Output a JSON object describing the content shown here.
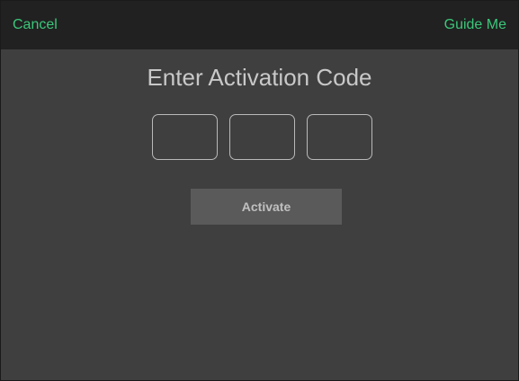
{
  "nav": {
    "cancel_label": "Cancel",
    "guide_label": "Guide Me"
  },
  "main": {
    "title": "Enter Activation Code",
    "code_fields": [
      {
        "value": ""
      },
      {
        "value": ""
      },
      {
        "value": ""
      }
    ],
    "activate_label": "Activate"
  },
  "colors": {
    "accent": "#3bc77a",
    "nav_background": "#212121",
    "background": "#3f3f3f",
    "button_background": "#5a5a5a"
  }
}
